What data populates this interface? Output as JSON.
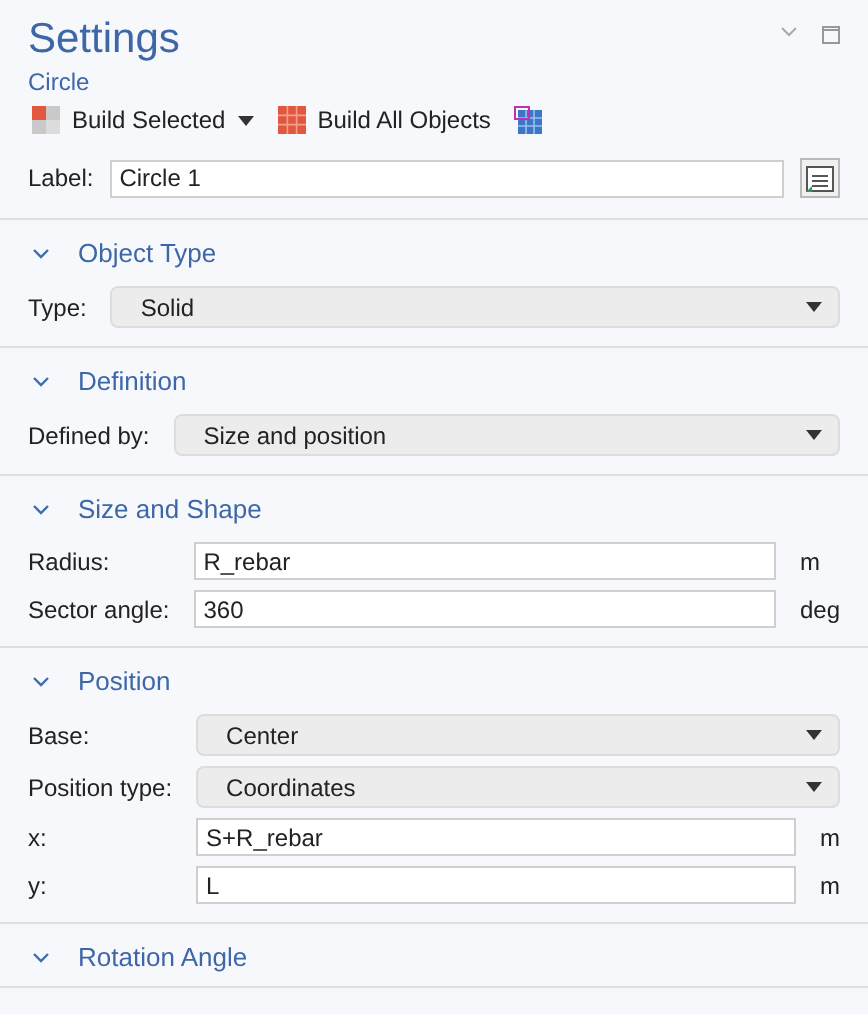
{
  "header": {
    "title": "Settings",
    "subtitle": "Circle"
  },
  "toolbar": [
    {
      "label": "Build Selected",
      "has_menu": true,
      "kind": "selected"
    },
    {
      "label": "Build All Objects",
      "has_menu": false,
      "kind": "all"
    },
    {
      "has_menu": false,
      "kind": "update"
    }
  ],
  "label_field": {
    "label": "Label:",
    "value": "Circle 1"
  },
  "sections": [
    {
      "title": "Object Type",
      "expanded": true,
      "rows": [
        {
          "kind": "select",
          "label": "Type:",
          "value": "Solid"
        }
      ]
    },
    {
      "title": "Definition",
      "expanded": true,
      "rows": [
        {
          "kind": "select",
          "label": "Defined by:",
          "value": "Size and position"
        }
      ]
    },
    {
      "title": "Size and Shape",
      "expanded": true,
      "rows": [
        {
          "kind": "text",
          "label": "Radius:",
          "value": "R_rebar",
          "unit": "m"
        },
        {
          "kind": "text",
          "label": "Sector angle:",
          "value": "360",
          "unit": "deg"
        }
      ]
    },
    {
      "title": "Position",
      "expanded": true,
      "rows": [
        {
          "kind": "select",
          "label": "Base:",
          "value": "Center"
        },
        {
          "kind": "select",
          "label": "Position type:",
          "value": "Coordinates"
        },
        {
          "kind": "text",
          "label": "x:",
          "value": "S+R_rebar",
          "unit": "m"
        },
        {
          "kind": "text",
          "label": "y:",
          "value": "L",
          "unit": "m"
        }
      ]
    },
    {
      "title": "Rotation Angle",
      "expanded": true
    }
  ]
}
